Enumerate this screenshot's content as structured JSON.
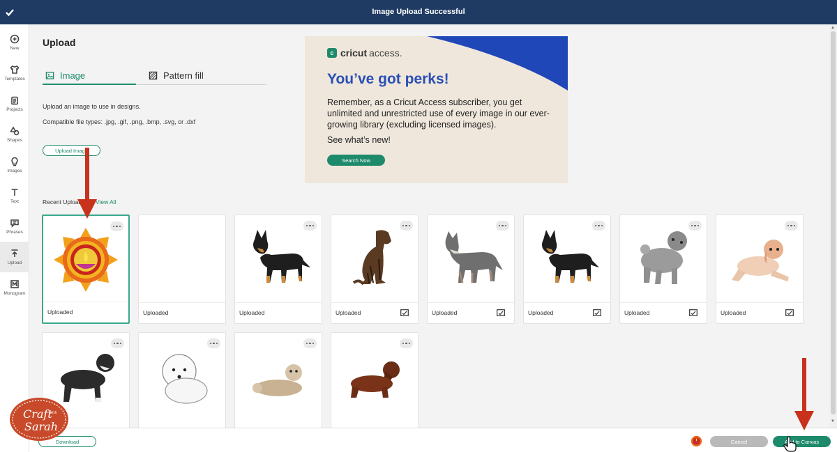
{
  "header": {
    "title": "Image Upload Successful"
  },
  "sidebar": {
    "items": [
      {
        "label": "New",
        "icon": "plus-circle-icon"
      },
      {
        "label": "Templates",
        "icon": "shirt-icon"
      },
      {
        "label": "Projects",
        "icon": "clipboard-icon"
      },
      {
        "label": "Shapes",
        "icon": "shapes-icon"
      },
      {
        "label": "Images",
        "icon": "lightbulb-icon"
      },
      {
        "label": "Text",
        "icon": "text-icon"
      },
      {
        "label": "Phrases",
        "icon": "speech-bubble-icon"
      },
      {
        "label": "Upload",
        "icon": "upload-icon"
      },
      {
        "label": "Monogram",
        "icon": "monogram-icon"
      }
    ],
    "active": "Upload"
  },
  "panel": {
    "title": "Upload",
    "tabs": [
      {
        "label": "Image",
        "icon": "image-icon",
        "active": true
      },
      {
        "label": "Pattern fill",
        "icon": "pattern-icon",
        "active": false
      }
    ],
    "description": "Upload an image to use in designs.",
    "filetypes": "Compatible file types: .jpg, .gif, .png, .bmp, .svg, or .dxf",
    "upload_button": "Upload Image"
  },
  "promo": {
    "logo_brand": "cricut",
    "logo_access": "access.",
    "title": "You’ve got perks!",
    "body": "Remember, as a Cricut Access subscriber, you get unlimited and unrestricted use of every image in our ever-growing library (excluding licensed images).",
    "cta": "See what’s new!",
    "button": "Search Now"
  },
  "recent": {
    "label": "Recent Uploads",
    "view_all": "View All",
    "tiles": [
      {
        "image": "diya-mandala-image",
        "caption": "Uploaded",
        "selected": true,
        "status_icon": false
      },
      {
        "image": "blank-image",
        "caption": "Uploaded",
        "selected": false,
        "status_icon": false
      },
      {
        "image": "black-tan-dog-image",
        "caption": "Uploaded",
        "selected": false,
        "status_icon": false
      },
      {
        "image": "brindle-boxer-dog-image",
        "caption": "Uploaded",
        "selected": false,
        "status_icon": true
      },
      {
        "image": "grey-wolf-dog-image",
        "caption": "Uploaded",
        "selected": false,
        "status_icon": true
      },
      {
        "image": "black-tan-dog-image",
        "caption": "Uploaded",
        "selected": false,
        "status_icon": true
      },
      {
        "image": "grey-fluffy-dog-image",
        "caption": "Uploaded",
        "selected": false,
        "status_icon": true
      },
      {
        "image": "peach-spaniel-dog-image",
        "caption": "Uploaded",
        "selected": false,
        "status_icon": true
      },
      {
        "image": "black-white-doodle-image",
        "caption": "",
        "selected": false,
        "status_icon": false
      },
      {
        "image": "white-fluffy-dog-image",
        "caption": "",
        "selected": false,
        "status_icon": false
      },
      {
        "image": "lying-poodle-image",
        "caption": "",
        "selected": false,
        "status_icon": false
      },
      {
        "image": "brown-spaniel-image",
        "caption": "",
        "selected": false,
        "status_icon": false
      }
    ]
  },
  "footer": {
    "download": "Download",
    "cancel": "Cancel",
    "add_to_canvas": "Add to Canvas"
  },
  "watermark": {
    "line1": "Craft",
    "line2": "with",
    "line3": "Sarah"
  },
  "colors": {
    "header": "#1f3b63",
    "accent": "#1e8a6c",
    "promo_blue": "#2a4fb5",
    "arrow": "#c8321d"
  }
}
